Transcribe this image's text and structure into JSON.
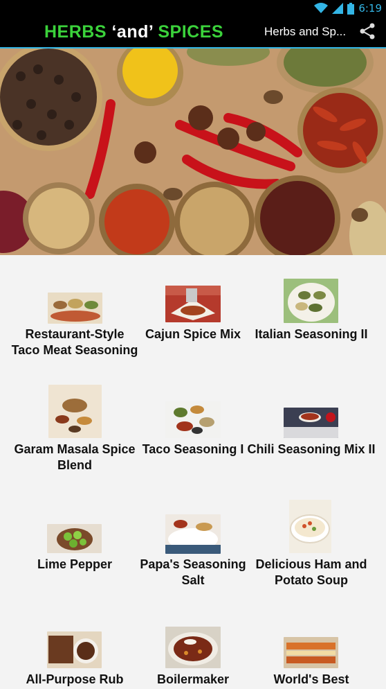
{
  "status_bar": {
    "time": "6:19",
    "icons": [
      "wifi-icon",
      "signal-icon",
      "battery-icon"
    ],
    "accent_color": "#33b5e5"
  },
  "action_bar": {
    "title_part1": "HERBS ",
    "title_part2": "‘and’",
    "title_part3": " SPICES",
    "title_color": "#3bd23b",
    "spinner_text": "Herbs and Sp...",
    "share_icon": "share-icon"
  },
  "banner": {
    "description_icon": "spices-banner-photo"
  },
  "recipes": [
    {
      "label": "Restaurant-Style Taco Meat Seasoning"
    },
    {
      "label": "Cajun Spice Mix"
    },
    {
      "label": "Italian Seasoning II"
    },
    {
      "label": "Garam Masala Spice Blend"
    },
    {
      "label": "Taco Seasoning I"
    },
    {
      "label": "Chili Seasoning Mix II"
    },
    {
      "label": "Lime Pepper"
    },
    {
      "label": "Papa's Seasoning Salt"
    },
    {
      "label": "Delicious Ham and Potato Soup"
    },
    {
      "label": "All-Purpose Rub"
    },
    {
      "label": "Boilermaker"
    },
    {
      "label": "World's Best"
    }
  ]
}
